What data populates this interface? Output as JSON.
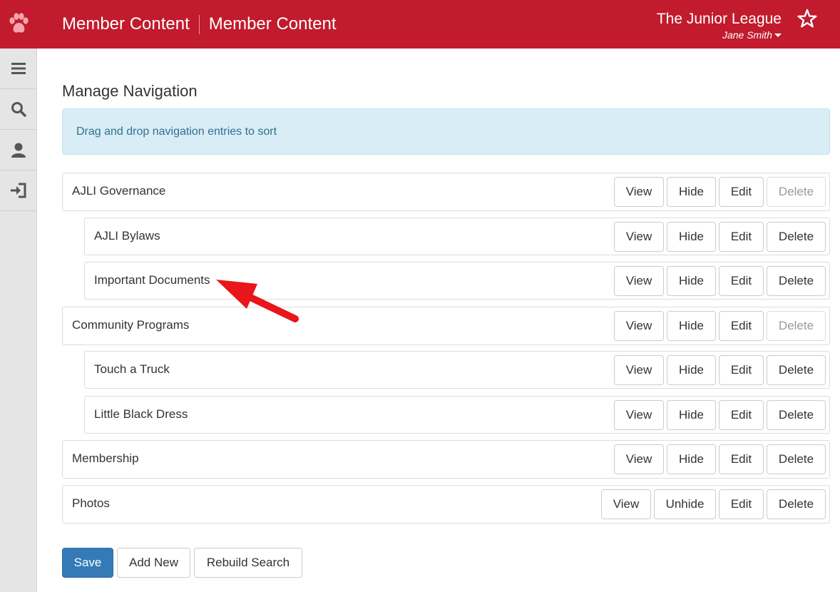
{
  "header": {
    "title_left": "Member Content",
    "title_right": "Member Content",
    "org_name": "The Junior League",
    "user_name": "Jane Smith",
    "logo_icon": "paw-icon",
    "favorite_icon": "star-icon"
  },
  "sidebar": {
    "items": [
      {
        "icon": "menu-icon"
      },
      {
        "icon": "search-icon"
      },
      {
        "icon": "user-icon"
      },
      {
        "icon": "sign-in-icon"
      }
    ]
  },
  "page": {
    "title": "Manage Navigation",
    "alert": "Drag and drop navigation entries to sort"
  },
  "navigation": [
    {
      "label": "AJLI Governance",
      "level": 0,
      "buttons": [
        "View",
        "Hide",
        "Edit",
        "Delete"
      ],
      "delete_disabled": true
    },
    {
      "label": "AJLI Bylaws",
      "level": 1,
      "buttons": [
        "View",
        "Hide",
        "Edit",
        "Delete"
      ],
      "delete_disabled": false
    },
    {
      "label": "Important Documents",
      "level": 1,
      "buttons": [
        "View",
        "Hide",
        "Edit",
        "Delete"
      ],
      "delete_disabled": false
    },
    {
      "label": "Community Programs",
      "level": 0,
      "buttons": [
        "View",
        "Hide",
        "Edit",
        "Delete"
      ],
      "delete_disabled": true
    },
    {
      "label": "Touch a Truck",
      "level": 1,
      "buttons": [
        "View",
        "Hide",
        "Edit",
        "Delete"
      ],
      "delete_disabled": false
    },
    {
      "label": "Little Black Dress",
      "level": 1,
      "buttons": [
        "View",
        "Hide",
        "Edit",
        "Delete"
      ],
      "delete_disabled": false
    },
    {
      "label": "Membership",
      "level": 0,
      "buttons": [
        "View",
        "Hide",
        "Edit",
        "Delete"
      ],
      "delete_disabled": false
    },
    {
      "label": "Photos",
      "level": 0,
      "buttons": [
        "View",
        "Unhide",
        "Edit",
        "Delete"
      ],
      "delete_disabled": false
    }
  ],
  "actions": {
    "save": "Save",
    "add_new": "Add New",
    "rebuild_search": "Rebuild Search"
  },
  "colors": {
    "brand": "#c11b2d",
    "primary": "#337ab7",
    "alert_bg": "#d9edf7",
    "annotation": "#e8161a"
  }
}
